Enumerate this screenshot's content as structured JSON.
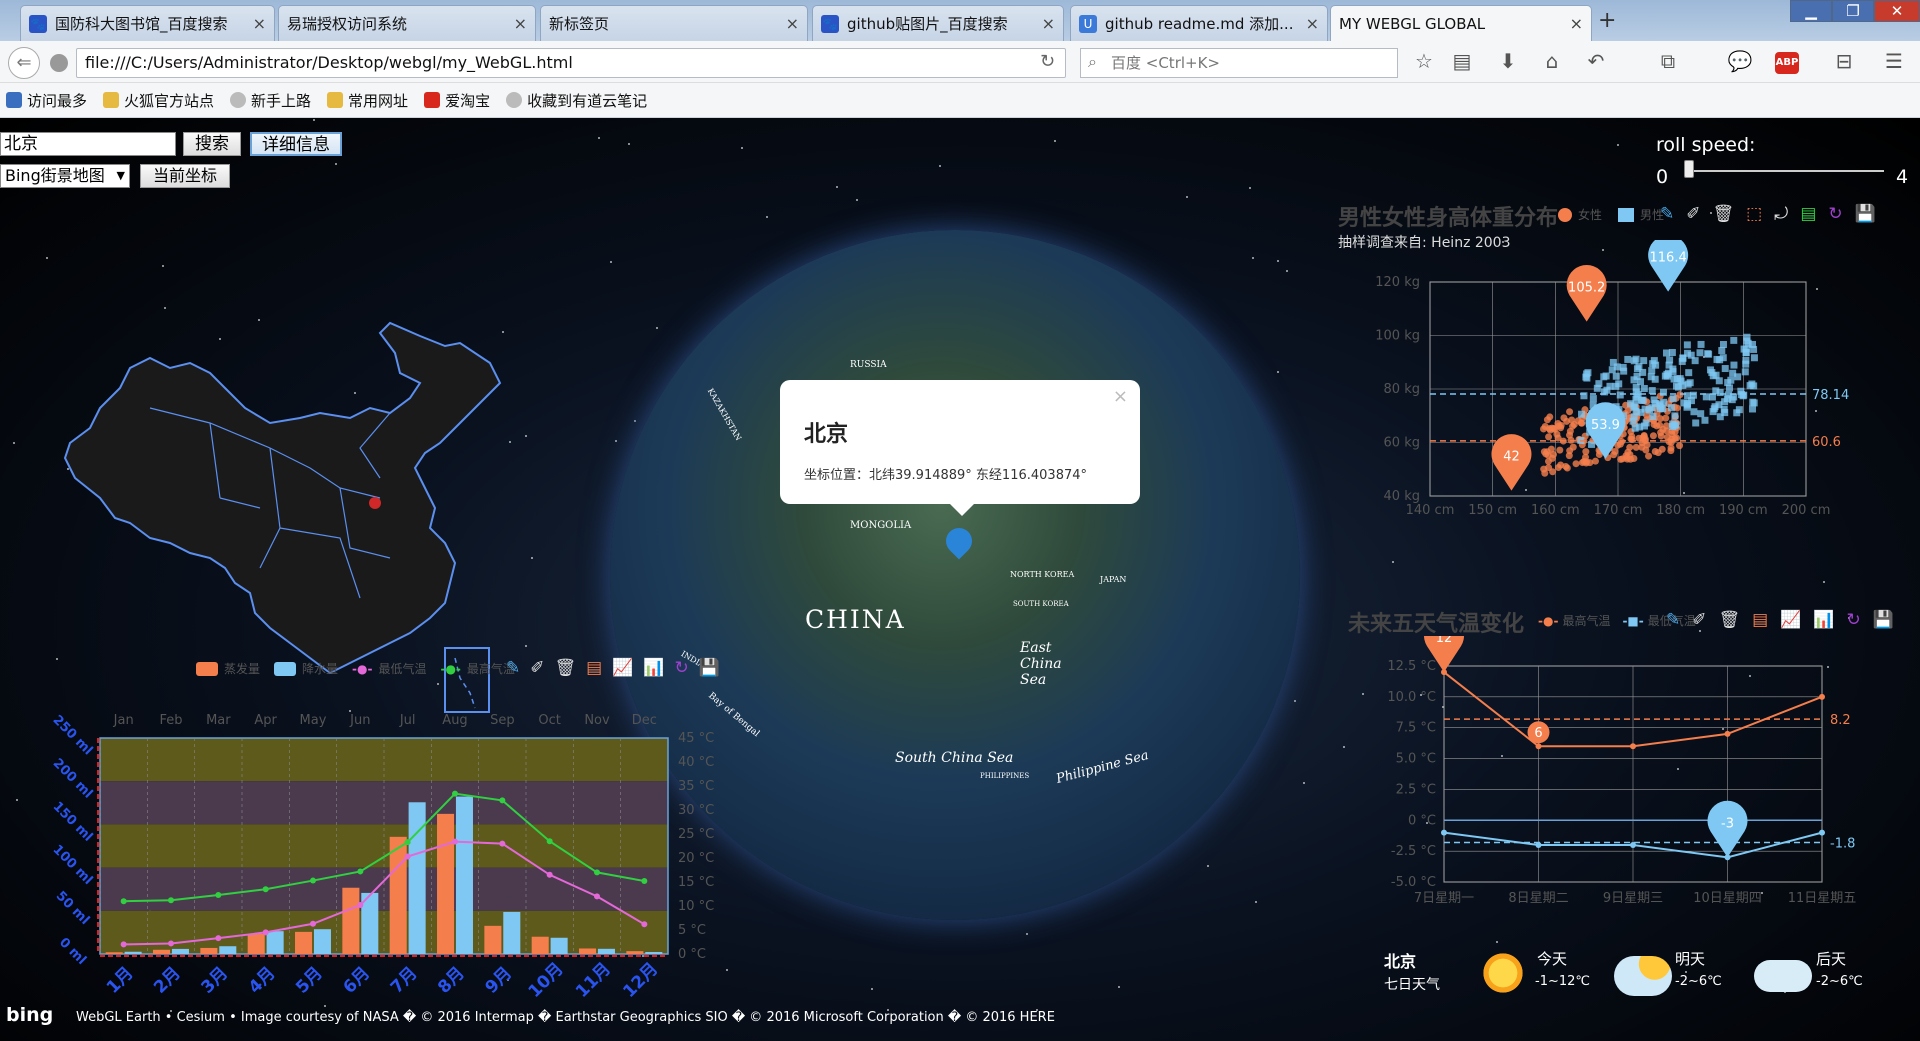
{
  "browser": {
    "tabs": [
      {
        "label": "国防科大图书馆_百度搜索",
        "icon": "baidu-paw-icon"
      },
      {
        "label": "易瑞授权访问系统",
        "icon": ""
      },
      {
        "label": "新标签页",
        "icon": ""
      },
      {
        "label": "github贴图片_百度搜索",
        "icon": "baidu-paw-icon"
      },
      {
        "label": "github readme.md 添加...",
        "icon": "ucweb-icon"
      },
      {
        "label": "MY WEBGL GLOBAL",
        "icon": ""
      }
    ],
    "url": "file:///C:/Users/Administrator/Desktop/webgl/my_WebGL.html",
    "search_placeholder": "百度 <Ctrl+K>",
    "bookmarks": [
      "访问最多",
      "火狐官方站点",
      "新手上路",
      "常用网址",
      "爱淘宝",
      "收藏到有道云笔记"
    ]
  },
  "controls": {
    "search_value": "北京",
    "search_button": "搜索",
    "detail_button": "详细信息",
    "map_select": "Bing街景地图",
    "coord_button": "当前坐标",
    "roll_label": "roll speed:",
    "roll_min": "0",
    "roll_max": "4",
    "roll_value": 0
  },
  "globe": {
    "labels": [
      "CHINA",
      "RUSSIA",
      "MONGOLIA",
      "East China Sea",
      "South China Sea",
      "Philippine Sea",
      "Bay of Bengal",
      "NORTH KOREA",
      "SOUTH KOREA",
      "JAPAN",
      "INDIA",
      "PHILIPPINES",
      "KAZAKHSTAN"
    ]
  },
  "popup": {
    "title": "北京",
    "text": "坐标位置：北纬39.914889° 东经116.403874°",
    "close": "×"
  },
  "credits": {
    "logo": "bing",
    "text": "WebGL Earth • Cesium • Image courtesy of NASA � © 2016 Intermap � Earthstar Geographics SIO � © 2016 Microsoft Corporation � © 2016 HERE"
  },
  "weather": {
    "city": "北京",
    "sub": "七日天气",
    "days": [
      {
        "name": "今天",
        "range": "-1~12℃",
        "icon": "sun-icon"
      },
      {
        "name": "明天",
        "range": "-2~6℃",
        "icon": "sun-cloud-icon"
      },
      {
        "name": "后天",
        "range": "-2~6℃",
        "icon": "cloud-icon"
      }
    ]
  },
  "colors": {
    "orange": "#f47e4c",
    "blue": "#7ec8f3",
    "green": "#30d040",
    "pink": "#e468d8",
    "china": "#5b8ff0"
  },
  "chart_data": [
    {
      "type": "scatter",
      "title": "男性女性身高体重分布",
      "subtitle": "抽样调查来自: Heinz 2003",
      "legend": [
        "女性",
        "男性"
      ],
      "x_ticks": [
        "140 cm",
        "150 cm",
        "160 cm",
        "170 cm",
        "180 cm",
        "190 cm",
        "200 cm"
      ],
      "y_ticks": [
        "40 kg",
        "60 kg",
        "80 kg",
        "100 kg",
        "120 kg"
      ],
      "xlim": [
        140,
        200
      ],
      "ylim": [
        40,
        120
      ],
      "markers": [
        {
          "series": "女性",
          "label": "105.2",
          "x": 165,
          "y": 105.2
        },
        {
          "series": "男性",
          "label": "116.4",
          "x": 178,
          "y": 116.4
        },
        {
          "series": "男性",
          "label": "53.9",
          "x": 168,
          "y": 53.9
        },
        {
          "series": "女性",
          "label": "42",
          "x": 153,
          "y": 42
        }
      ],
      "mark_lines": [
        {
          "series": "男性",
          "label": "78.14",
          "y": 78.14
        },
        {
          "series": "女性",
          "label": "60.6",
          "y": 60.6
        }
      ]
    },
    {
      "type": "line",
      "title": "未来五天气温变化",
      "legend": [
        "最高气温",
        "最低气温"
      ],
      "categories": [
        "7日星期一",
        "8日星期二",
        "9日星期三",
        "10日星期四",
        "11日星期五"
      ],
      "y_ticks": [
        "-5.0 °C",
        "-2.5 °C",
        "0 °C",
        "2.5 °C",
        "5.0 °C",
        "7.5 °C",
        "10.0 °C",
        "12.5 °C"
      ],
      "ylim": [
        -5,
        12.5
      ],
      "series": [
        {
          "name": "最高气温",
          "values": [
            12,
            6,
            6,
            7,
            10
          ]
        },
        {
          "name": "最低气温",
          "values": [
            -1,
            -2,
            -2,
            -3,
            -1
          ]
        }
      ],
      "max_labels": [
        "12",
        "-3"
      ],
      "min_label": "6",
      "avg_labels": [
        "8.2",
        "-1.8"
      ]
    },
    {
      "type": "bar",
      "legend": [
        "蒸发量",
        "降水量",
        "最低气温",
        "最高气温"
      ],
      "categories": [
        "Jan",
        "Feb",
        "Mar",
        "Apr",
        "May",
        "Jun",
        "Jul",
        "Aug",
        "Sep",
        "Oct",
        "Nov",
        "Dec"
      ],
      "bottom_categories": [
        "1月",
        "2月",
        "3月",
        "4月",
        "5月",
        "6月",
        "7月",
        "8月",
        "9月",
        "10月",
        "11月",
        "12月"
      ],
      "left_ticks": [
        "0 ml",
        "50 ml",
        "100 ml",
        "150 ml",
        "200 ml",
        "250 ml"
      ],
      "right_ticks": [
        "0 °C",
        "5 °C",
        "10 °C",
        "15 °C",
        "20 °C",
        "25 °C",
        "30 °C",
        "35 °C",
        "40 °C",
        "45 °C"
      ],
      "ylim": [
        0,
        250
      ],
      "series": [
        {
          "name": "蒸发量",
          "values": [
            2.0,
            4.9,
            7.0,
            23.2,
            25.6,
            76.7,
            135.6,
            162.2,
            32.6,
            20.0,
            6.4,
            3.3
          ]
        },
        {
          "name": "降水量",
          "values": [
            2.6,
            5.9,
            9.0,
            26.4,
            28.7,
            70.7,
            175.6,
            182.2,
            48.7,
            18.8,
            6.0,
            2.3
          ]
        },
        {
          "name": "最低气温",
          "values": [
            2.0,
            2.2,
            3.3,
            4.5,
            6.3,
            10.2,
            20.3,
            23.4,
            23.0,
            16.5,
            12.0,
            6.2
          ]
        },
        {
          "name": "最高气温",
          "values": [
            11.0,
            11.2,
            12.3,
            13.5,
            15.3,
            17.2,
            23.3,
            33.4,
            32.0,
            23.5,
            17.0,
            15.2
          ]
        }
      ],
      "right_ylim": [
        0,
        45
      ]
    }
  ]
}
